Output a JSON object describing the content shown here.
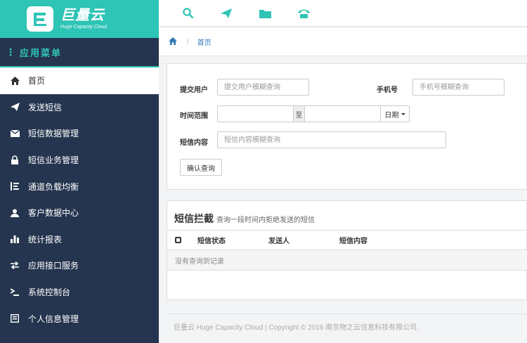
{
  "brand": {
    "name": "巨量云",
    "subtitle": "Huge Capacity Cloud"
  },
  "sidebar": {
    "header": "应用菜单",
    "items": [
      {
        "label": "首页",
        "icon": "home-icon",
        "active": true
      },
      {
        "label": "发送短信",
        "icon": "send-icon"
      },
      {
        "label": "短信数据管理",
        "icon": "envelope-icon"
      },
      {
        "label": "短信业务管理",
        "icon": "lock-icon"
      },
      {
        "label": "通道负载均衡",
        "icon": "indent-icon"
      },
      {
        "label": "客户数据中心",
        "icon": "user-icon"
      },
      {
        "label": "统计报表",
        "icon": "bar-chart-icon"
      },
      {
        "label": "应用接口服务",
        "icon": "transfer-icon"
      },
      {
        "label": "系统控制台",
        "icon": "terminal-icon"
      },
      {
        "label": "个人信息管理",
        "icon": "card-icon"
      }
    ]
  },
  "topbar": {
    "icons": [
      "search-icon",
      "send-icon",
      "folder-icon",
      "phone-icon"
    ]
  },
  "breadcrumb": {
    "sep": "/",
    "current": "首页"
  },
  "search": {
    "submit_user_label": "提交用户",
    "submit_user_placeholder": "提交用户模糊查询",
    "phone_label": "手机号",
    "phone_placeholder": "手机号模糊查询",
    "time_label": "时间范围",
    "time_to": "至",
    "date_dropdown": "日期",
    "content_label": "短信内容",
    "content_placeholder": "短信内容模糊查询",
    "confirm_button": "确认查询"
  },
  "table": {
    "title": "短信拦截",
    "subtitle": "查询一段时间内拒绝发送的短信",
    "columns": [
      "短信状态",
      "发送人",
      "短信内容"
    ],
    "empty_text": "没有查询到记录"
  },
  "footer": {
    "text": "巨量云 Huge Capacity Cloud | Copyright © 2016 南京物之云信息科技有限公司."
  },
  "colors": {
    "accent": "#2ec4b6",
    "sidebar_bg": "#25354f",
    "link": "#337ab7"
  }
}
